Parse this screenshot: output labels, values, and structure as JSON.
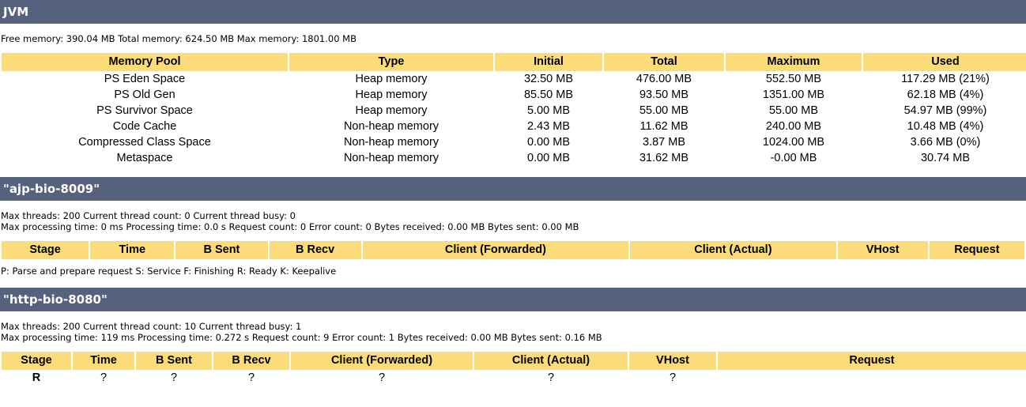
{
  "jvm": {
    "title": "JVM",
    "summary": "Free memory: 390.04 MB Total memory: 624.50 MB Max memory: 1801.00 MB",
    "columns": [
      "Memory Pool",
      "Type",
      "Initial",
      "Total",
      "Maximum",
      "Used"
    ],
    "rows": [
      [
        "PS Eden Space",
        "Heap memory",
        "32.50 MB",
        "476.00 MB",
        "552.50 MB",
        "117.29 MB (21%)"
      ],
      [
        "PS Old Gen",
        "Heap memory",
        "85.50 MB",
        "93.50 MB",
        "1351.00 MB",
        "62.18 MB (4%)"
      ],
      [
        "PS Survivor Space",
        "Heap memory",
        "5.00 MB",
        "55.00 MB",
        "55.00 MB",
        "54.97 MB (99%)"
      ],
      [
        "Code Cache",
        "Non-heap memory",
        "2.43 MB",
        "11.62 MB",
        "240.00 MB",
        "10.48 MB (4%)"
      ],
      [
        "Compressed Class Space",
        "Non-heap memory",
        "0.00 MB",
        "3.87 MB",
        "1024.00 MB",
        "3.66 MB (0%)"
      ],
      [
        "Metaspace",
        "Non-heap memory",
        "0.00 MB",
        "31.62 MB",
        "-0.00 MB",
        "30.74 MB"
      ]
    ]
  },
  "ajp": {
    "title": "\"ajp-bio-8009\"",
    "stats_line1": "Max threads: 200 Current thread count: 0 Current thread busy: 0",
    "stats_line2": "Max processing time: 0 ms Processing time: 0.0 s Request count: 0 Error count: 0 Bytes received: 0.00 MB Bytes sent: 0.00 MB",
    "columns": [
      "Stage",
      "Time",
      "B Sent",
      "B Recv",
      "Client (Forwarded)",
      "Client (Actual)",
      "VHost",
      "Request"
    ],
    "rows": [],
    "legend": "P: Parse and prepare request S: Service F: Finishing R: Ready K: Keepalive"
  },
  "http": {
    "title": "\"http-bio-8080\"",
    "stats_line1": "Max threads: 200 Current thread count: 10 Current thread busy: 1",
    "stats_line2": "Max processing time: 119 ms Processing time: 0.272 s Request count: 9 Error count: 1 Bytes received: 0.00 MB Bytes sent: 0.16 MB",
    "columns": [
      "Stage",
      "Time",
      "B Sent",
      "B Recv",
      "Client (Forwarded)",
      "Client (Actual)",
      "VHost",
      "Request"
    ],
    "rows": [
      [
        "R",
        "?",
        "?",
        "?",
        "?",
        "?",
        "?",
        ""
      ]
    ]
  },
  "colors": {
    "section_bar": "#56617D",
    "table_header": "#FCDB79",
    "text": "#000000",
    "background": "#FFFFFF"
  }
}
